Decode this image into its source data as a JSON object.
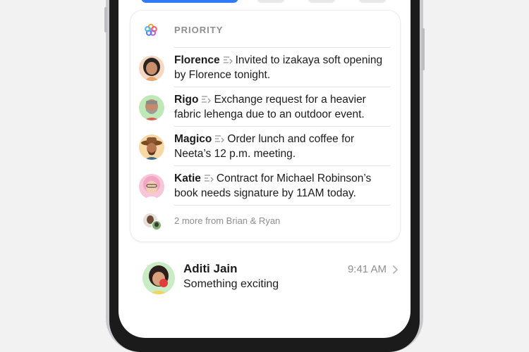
{
  "priority": {
    "label": "PRIORITY",
    "items": [
      {
        "name": "Florence",
        "text": "Invited to izakaya soft opening by Florence tonight.",
        "avatar_color": "#f6d7c2"
      },
      {
        "name": "Rigo",
        "text": "Exchange request for a heavier fabric lehenga due to an outdoor event.",
        "avatar_color": "#bfe8b7"
      },
      {
        "name": "Magico",
        "text": "Order lunch and coffee for Neeta’s 12 p.m. meeting.",
        "avatar_color": "#f8d8a6"
      },
      {
        "name": "Katie",
        "text": "Contract for Michael Robinson’s book needs signature by 11AM today.",
        "avatar_color": "#f7c6d8"
      }
    ],
    "more": "2 more from Brian & Ryan"
  },
  "mail": {
    "sender": "Aditi Jain",
    "time": "9:41 AM",
    "subject": "Something exciting",
    "avatar_color": "#c9ecc4"
  },
  "icons": {
    "priority": "priority-sparkle-icon",
    "summary": "summary-lines-icon",
    "chevron": "chevron-right-icon"
  },
  "colors": {
    "accent": "#2f7bf6",
    "secondary_text": "#8e8e93"
  }
}
